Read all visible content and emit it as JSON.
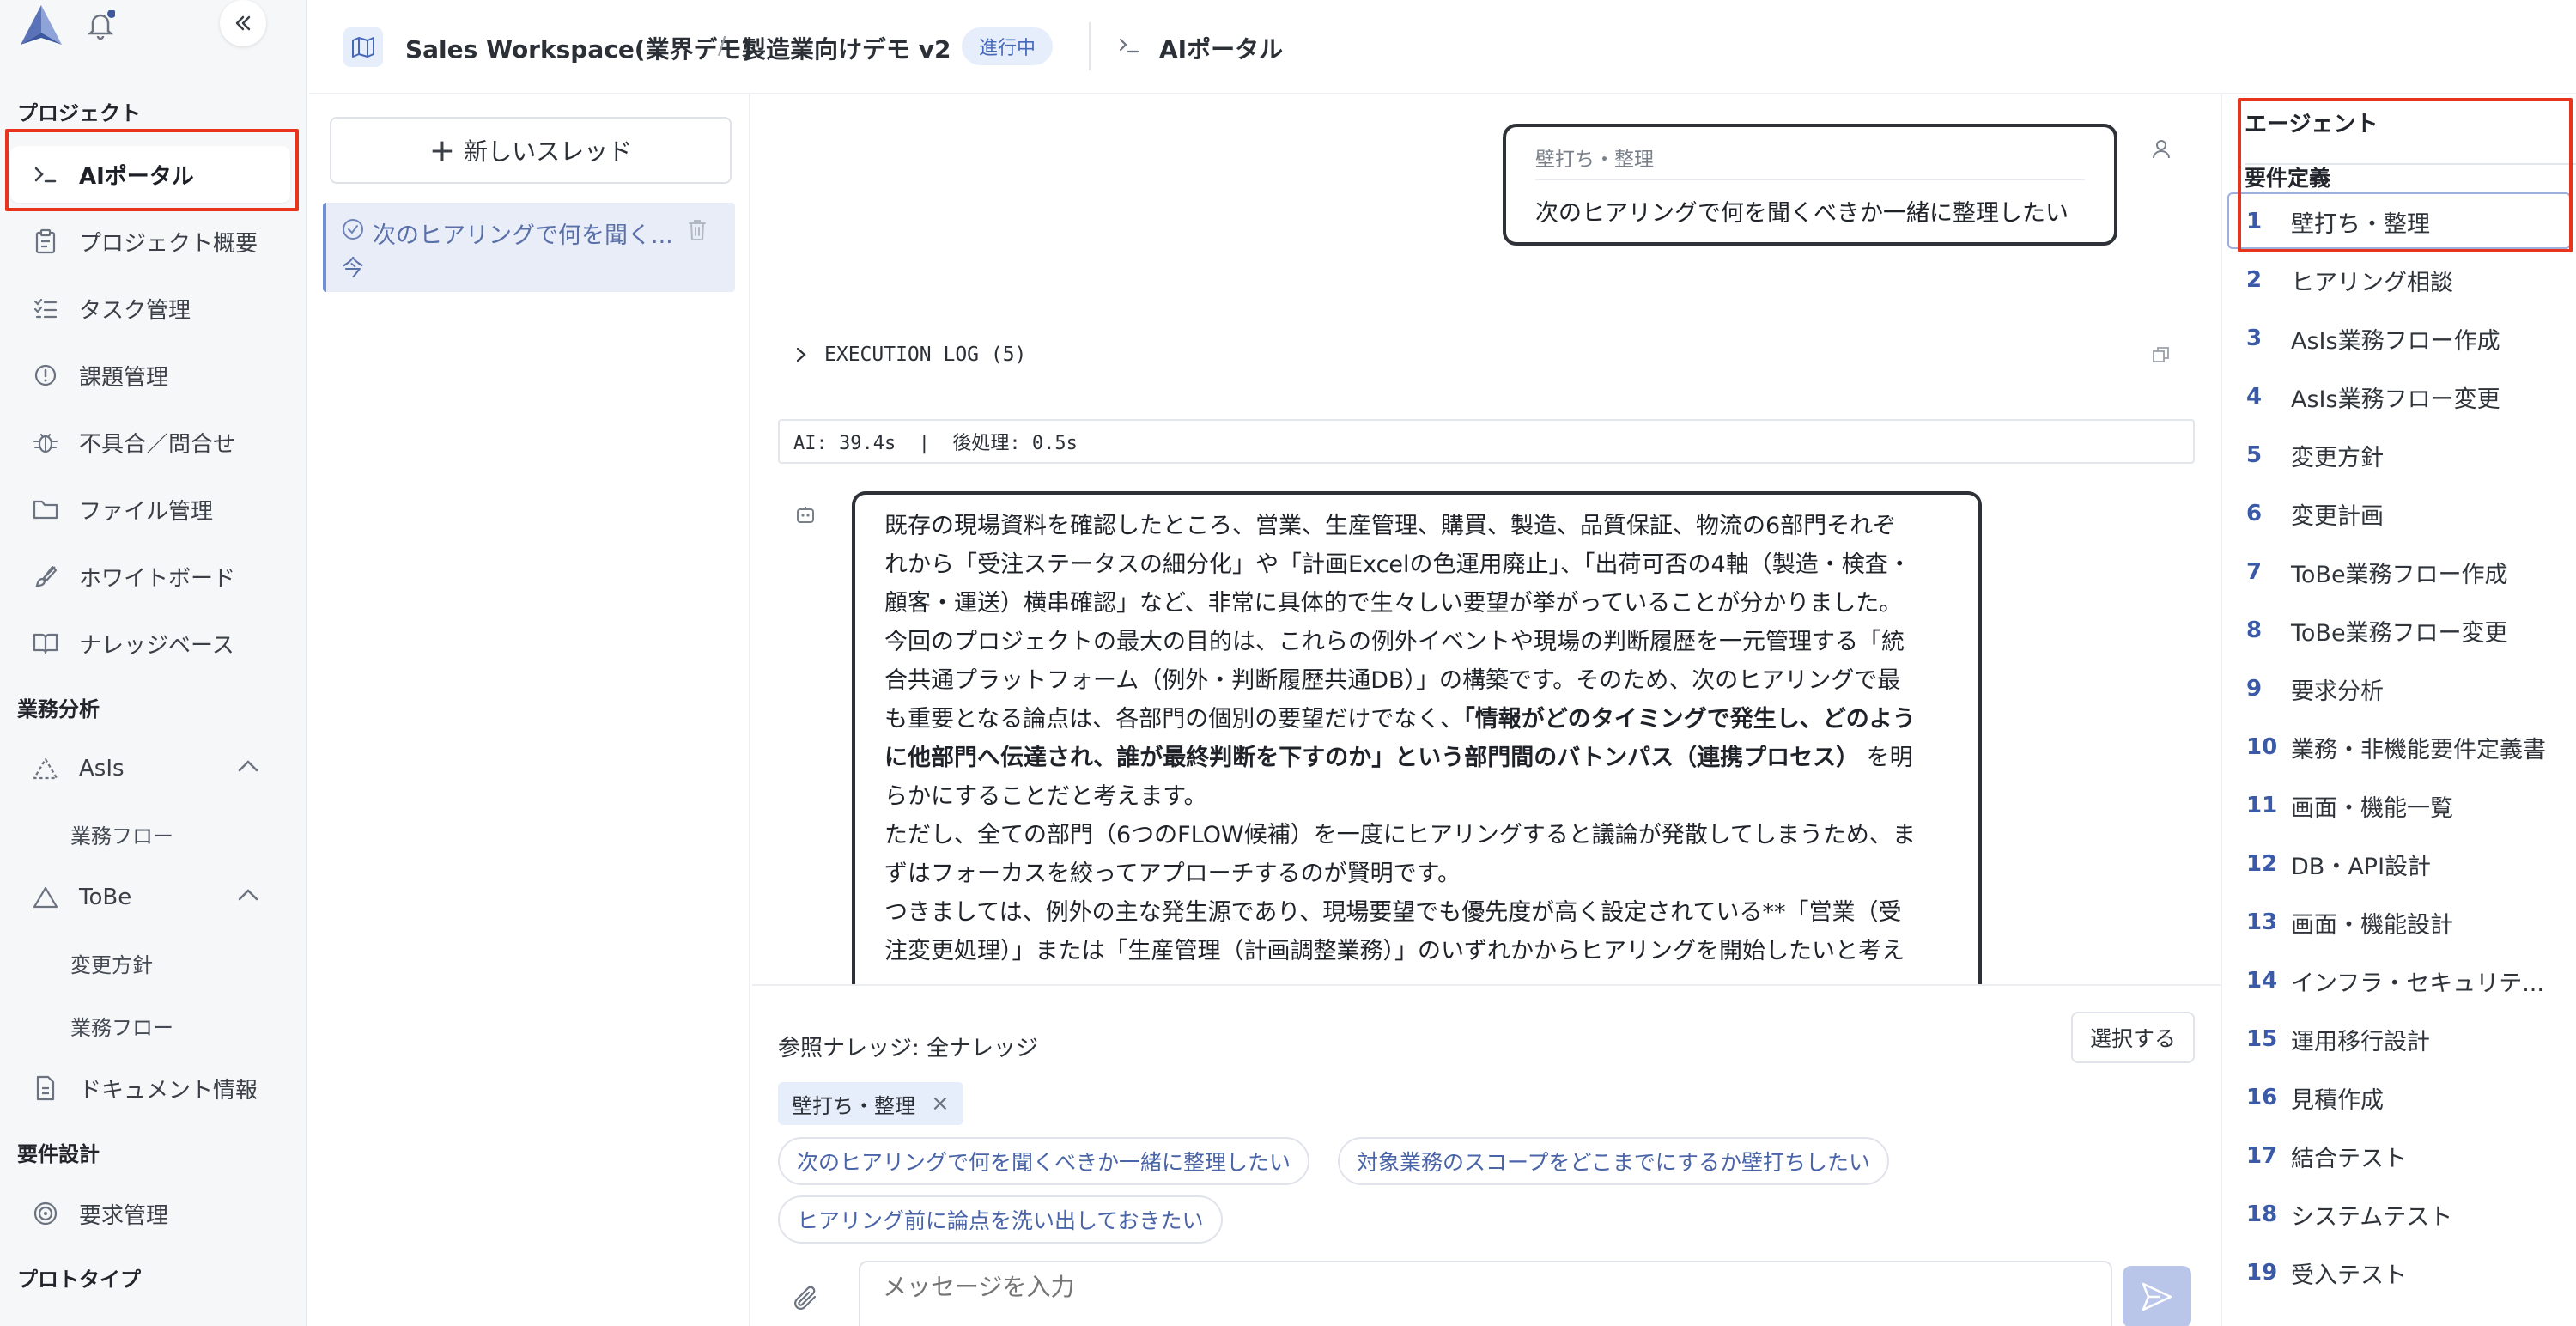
{
  "sidebar": {
    "sections": {
      "project": "プロジェクト",
      "business_analysis": "業務分析",
      "requirements_design": "要件設計",
      "prototype": "プロトタイプ"
    },
    "items": [
      {
        "label": "AIポータル",
        "icon": "terminal-icon"
      },
      {
        "label": "プロジェクト概要",
        "icon": "clipboard-icon"
      },
      {
        "label": "タスク管理",
        "icon": "checklist-icon"
      },
      {
        "label": "課題管理",
        "icon": "alert-circle-icon"
      },
      {
        "label": "不具合／問合せ",
        "icon": "bug-icon"
      },
      {
        "label": "ファイル管理",
        "icon": "folder-icon"
      },
      {
        "label": "ホワイトボード",
        "icon": "brush-icon"
      },
      {
        "label": "ナレッジベース",
        "icon": "book-icon"
      }
    ],
    "asis": {
      "label": "AsIs",
      "sub": "業務フロー"
    },
    "tobe": {
      "label": "ToBe",
      "subs": [
        "変更方針",
        "業務フロー"
      ]
    },
    "document": "ドキュメント情報",
    "requirements": "要求管理"
  },
  "header": {
    "workspace": "Sales Workspace(業界デモ)",
    "separator": "/",
    "project": "製造業向けデモ v2",
    "status_badge": "進行中",
    "page": "AIポータル"
  },
  "threads": {
    "new_thread": "新しいスレッド",
    "items": [
      {
        "title": "次のヒアリングで何を聞く...",
        "time": "今"
      }
    ]
  },
  "chat": {
    "user_message": {
      "tag": "壁打ち・整理",
      "text": "次のヒアリングで何を聞くべきか一緒に整理したい"
    },
    "execution_log": "EXECUTION LOG (5)",
    "timing": "AI: 39.4s  |  後処理: 0.5s",
    "ai_message": {
      "lines": [
        "既存の現場資料を確認したところ、営業、生産管理、購買、製造、品質保証、物流の6部門それぞ",
        "れから「受注ステータスの細分化」や「計画Excelの色運用廃止」、「出荷可否の4軸（製造・検査・",
        "顧客・運送）横串確認」など、非常に具体的で生々しい要望が挙がっていることが分かりました。",
        "今回のプロジェクトの最大の目的は、これらの例外イベントや現場の判断履歴を一元管理する「統",
        "合共通プラットフォーム（例外・判断履歴共通DB）」の構築です。そのため、次のヒアリングで最",
        "も重要となる論点は、各部門の個別の要望だけでなく、"
      ],
      "bold_1": "「情報がどのタイミングで発生し、どのよう",
      "bold_2": "に他部門へ伝達され、誰が最終判断を下すのか」という部門間のバトンパス（連携プロセス）",
      "after_bold": " を明",
      "line_after": "らかにすることだと考えます。",
      "para_2": [
        "ただし、全ての部門（6つのFLOW候補）を一度にヒアリングすると議論が発散してしまうため、ま",
        "ずはフォーカスを絞ってアプローチするのが賢明です。"
      ],
      "para_3": [
        "つきましては、例外の主な発生源であり、現場要望でも優先度が高く設定されている**「営業（受",
        "注変更処理）」または「生産管理（計画調整業務）」のいずれかからヒアリングを開始したいと考え"
      ]
    },
    "knowledge_label": "参照ナレッジ: 全ナレッジ",
    "select_button": "選択する",
    "active_tag": "壁打ち・整理",
    "suggestions": [
      "次のヒアリングで何を聞くべきか一緒に整理したい",
      "対象業務のスコープをどこまでにするか壁打ちしたい",
      "ヒアリング前に論点を洗い出しておきたい"
    ],
    "input_placeholder": "メッセージを入力"
  },
  "agents": {
    "title": "エージェント",
    "group": "要件定義",
    "items": [
      {
        "num": "1",
        "label": "壁打ち・整理"
      },
      {
        "num": "2",
        "label": "ヒアリング相談"
      },
      {
        "num": "3",
        "label": "AsIs業務フロー作成"
      },
      {
        "num": "4",
        "label": "AsIs業務フロー変更"
      },
      {
        "num": "5",
        "label": "変更方針"
      },
      {
        "num": "6",
        "label": "変更計画"
      },
      {
        "num": "7",
        "label": "ToBe業務フロー作成"
      },
      {
        "num": "8",
        "label": "ToBe業務フロー変更"
      },
      {
        "num": "9",
        "label": "要求分析"
      },
      {
        "num": "10",
        "label": "業務・非機能要件定義書"
      },
      {
        "num": "11",
        "label": "画面・機能一覧"
      },
      {
        "num": "12",
        "label": "DB・API設計"
      },
      {
        "num": "13",
        "label": "画面・機能設計"
      },
      {
        "num": "14",
        "label": "インフラ・セキュリテ..."
      },
      {
        "num": "15",
        "label": "運用移行設計"
      },
      {
        "num": "16",
        "label": "見積作成"
      },
      {
        "num": "17",
        "label": "結合テスト"
      },
      {
        "num": "18",
        "label": "システムテスト"
      },
      {
        "num": "19",
        "label": "受入テスト"
      }
    ]
  },
  "colors": {
    "accent": "#3a5aa8",
    "highlight_box": "#e8341c",
    "badge_bg": "#e7eefb"
  }
}
